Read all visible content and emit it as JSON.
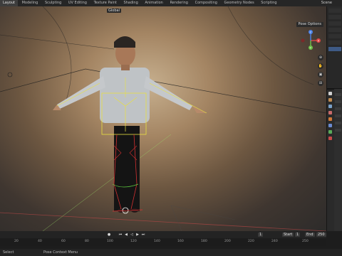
{
  "topbar": {
    "workspaces": [
      "Layout",
      "Modeling",
      "Sculpting",
      "UV Editing",
      "Texture Paint",
      "Shading",
      "Animation",
      "Rendering",
      "Compositing",
      "Geometry Nodes",
      "Scripting"
    ],
    "active_workspace": "Layout",
    "scene_label": "Scene"
  },
  "viewport": {
    "header": {
      "mode_dropdown": "Global",
      "pose_options": "Pose Options"
    },
    "gizmo_axes": {
      "x": "X",
      "y": "Y",
      "z": "Z"
    }
  },
  "timeline": {
    "start_label": "Start",
    "start_value": "1",
    "end_label": "End",
    "end_value": "250",
    "current_frame": "1"
  },
  "ruler": {
    "ticks": [
      "20",
      "40",
      "60",
      "80",
      "100",
      "120",
      "140",
      "160",
      "180",
      "200",
      "220",
      "240",
      "250"
    ]
  },
  "status": {
    "left_text": "Select",
    "mid_text": "Pose Context Menu"
  },
  "colors": {
    "active_tab": "#3d3d3d",
    "selection_blue": "#3e5a86",
    "bone_yellow": "#e8e040",
    "bone_red": "#d03030",
    "bone_green": "#60d040"
  }
}
